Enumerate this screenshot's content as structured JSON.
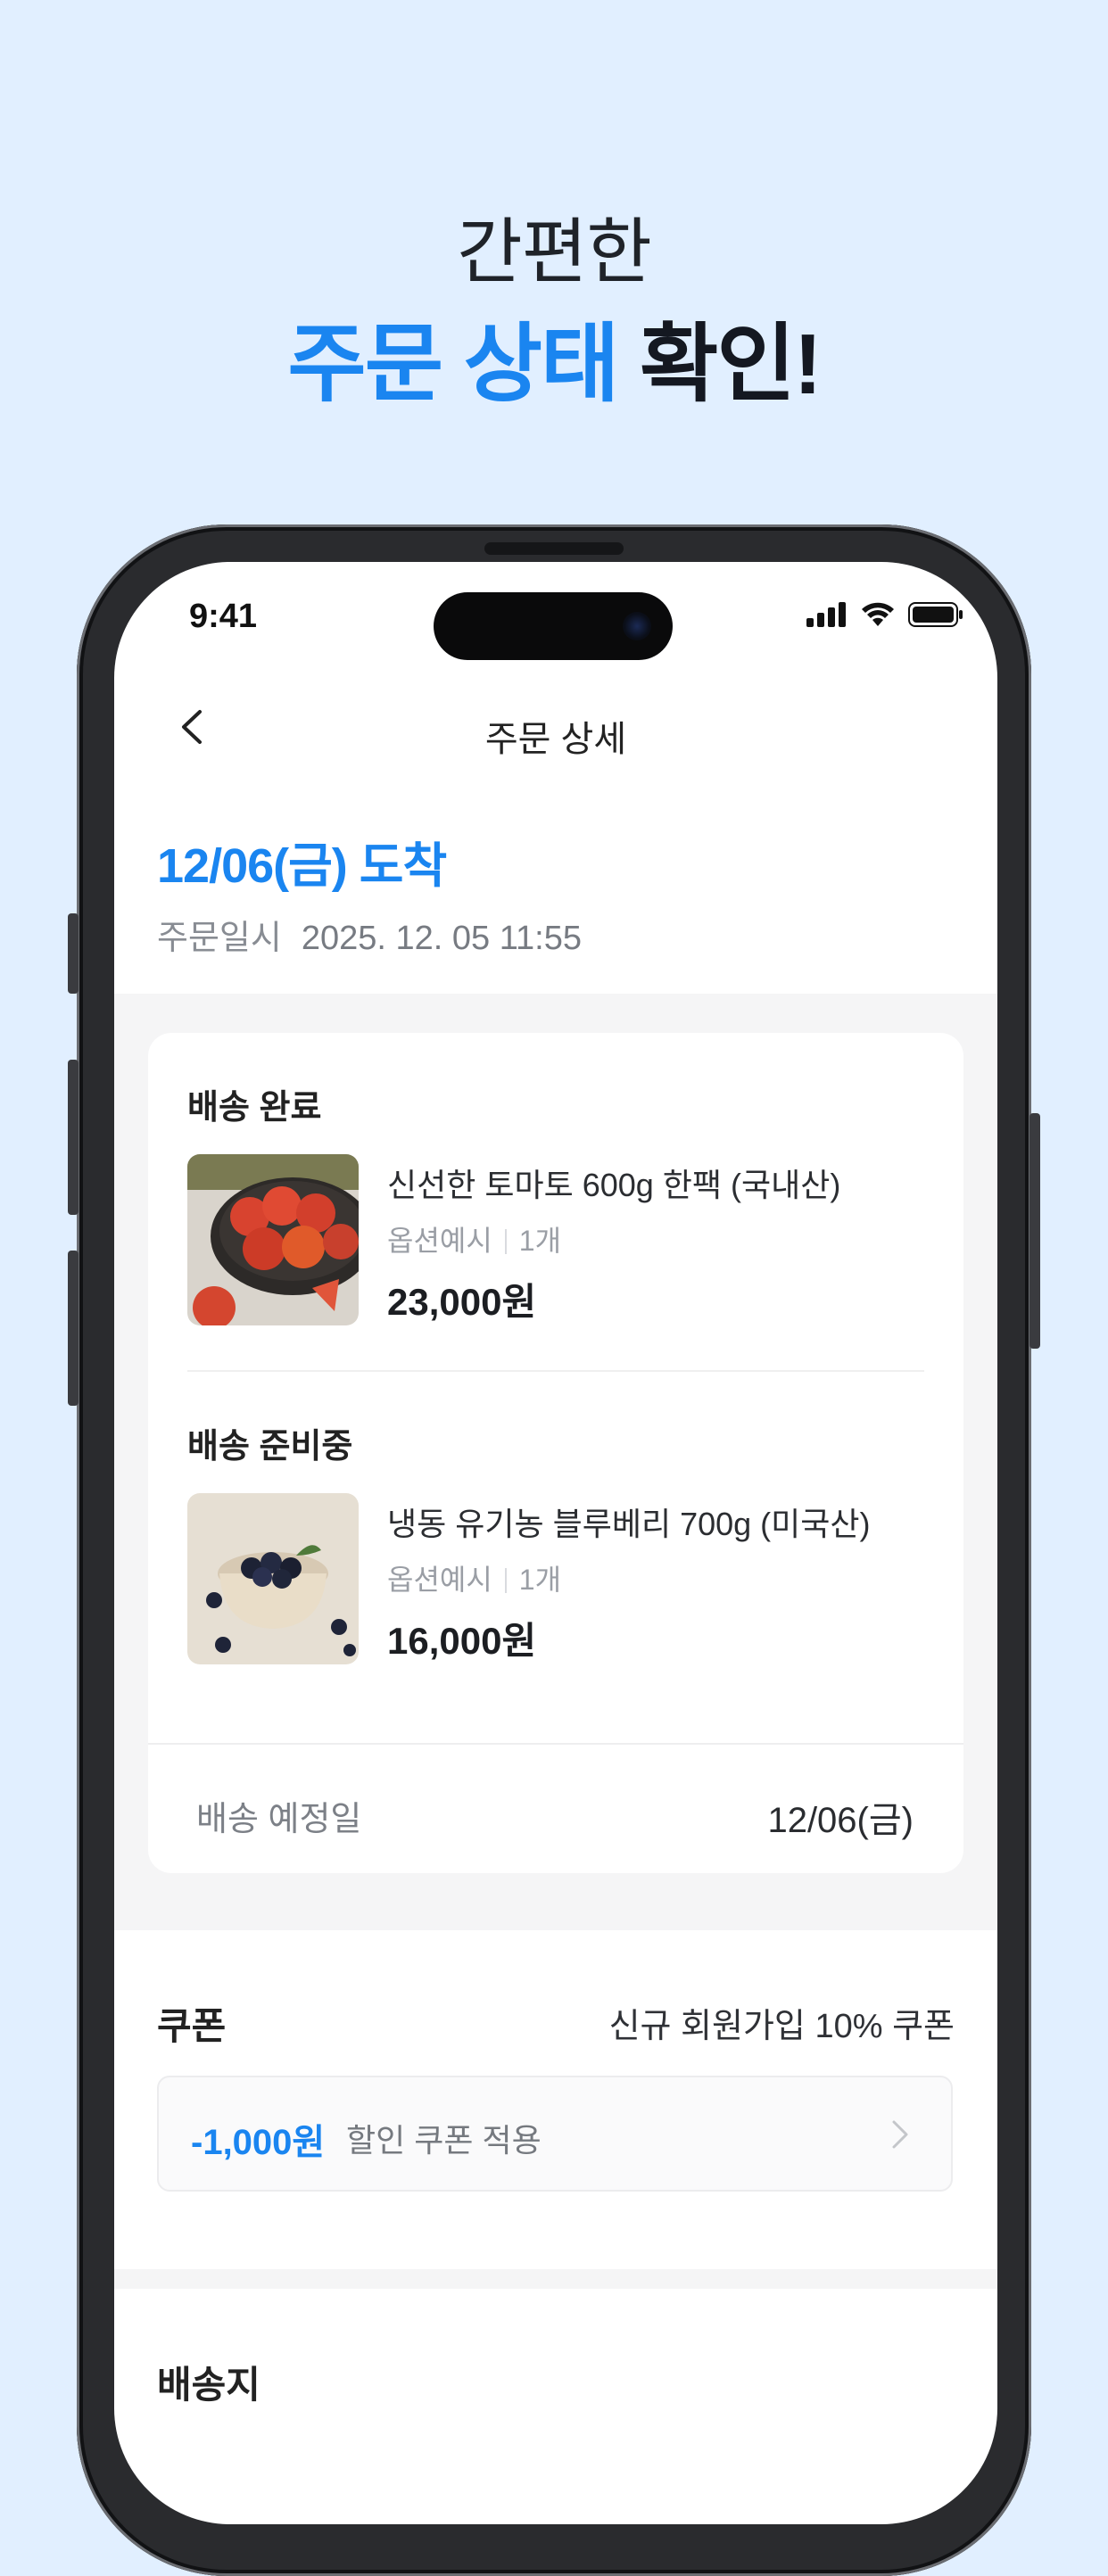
{
  "headline": {
    "line1": "간편한",
    "line2_accent": "주문 상태",
    "line2_rest": " 확인!"
  },
  "status_bar": {
    "time": "9:41"
  },
  "nav": {
    "title": "주문 상세"
  },
  "order": {
    "arrival": "12/06(금) 도착",
    "date_label": "주문일시",
    "date_value": "2025. 12. 05 11:55"
  },
  "items": [
    {
      "status": "배송 완료",
      "name": "신선한 토마토 600g 한팩 (국내산)",
      "option": "옵션예시",
      "qty": "1개",
      "price": "23,000원",
      "image": "tomato-photo"
    },
    {
      "status": "배송 준비중",
      "name": "냉동 유기농 블루베리 700g (미국산)",
      "option": "옵션예시",
      "qty": "1개",
      "price": "16,000원",
      "image": "blueberry-photo"
    }
  ],
  "shipping": {
    "label": "배송 예정일",
    "value": "12/06(금)"
  },
  "coupon": {
    "label": "쿠폰",
    "name": "신규 회원가입 10% 쿠폰",
    "amount": "-1,000원",
    "desc": "할인 쿠폰 적용"
  },
  "address": {
    "label": "배송지"
  },
  "colors": {
    "accent": "#1a85f0",
    "background": "#e1efff"
  }
}
